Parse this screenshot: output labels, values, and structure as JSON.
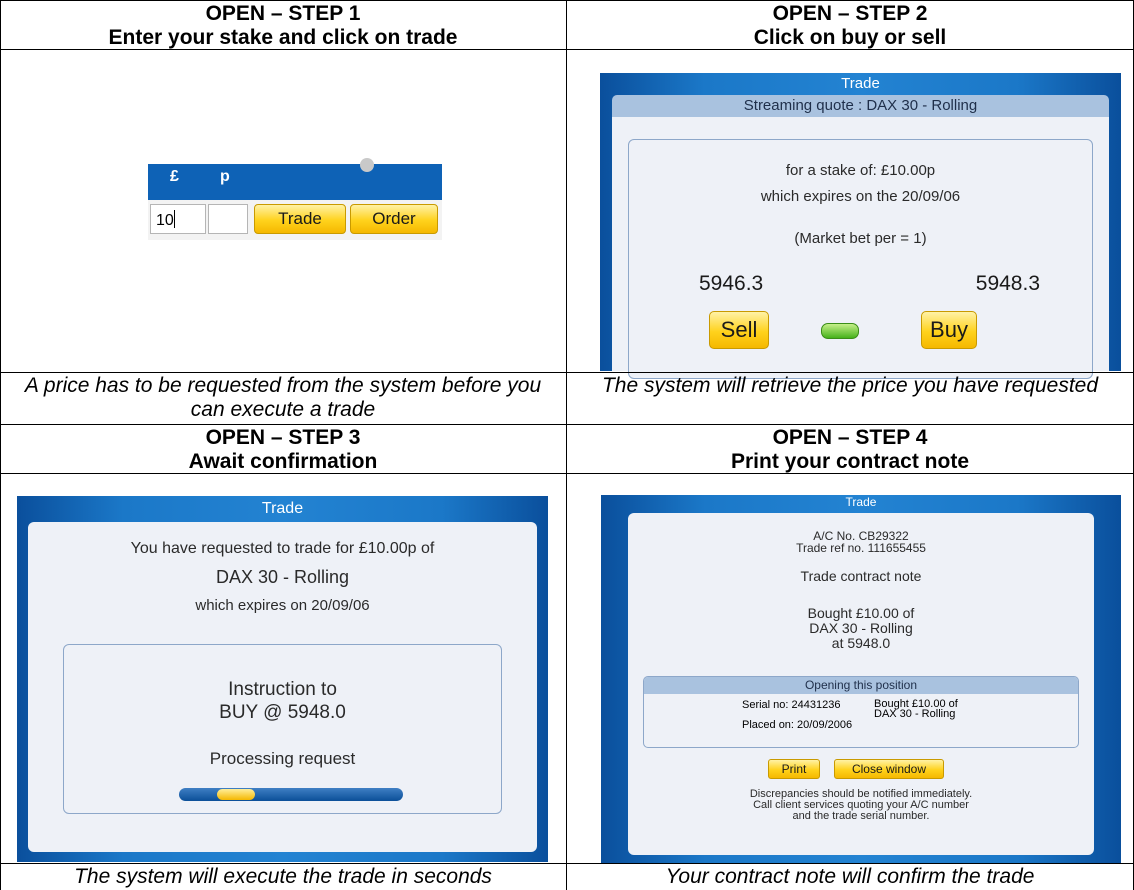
{
  "step1": {
    "heading": "OPEN – STEP 1",
    "subheading": "Enter your stake and click on trade",
    "currency_pound": "£",
    "currency_pence": "p",
    "stake_value": "10",
    "trade_button": "Trade",
    "order_button": "Order",
    "caption": "A price has to be requested from the system before you can execute a trade"
  },
  "step2": {
    "heading": "OPEN – STEP 2",
    "subheading": "Click on buy or sell",
    "dialog_title": "Trade",
    "quote_title": "Streaming quote : DAX 30 - Rolling",
    "stake_text": "for a stake of: £10.00p",
    "expiry_text": "which expires on the 20/09/06",
    "market_bet": "(Market bet per = 1)",
    "sell_price": "5946.3",
    "buy_price": "5948.3",
    "sell_button": "Sell",
    "buy_button": "Buy",
    "caption": "The system will retrieve the price you have requested"
  },
  "step3": {
    "heading": "OPEN – STEP 3",
    "subheading": "Await confirmation",
    "dialog_title": "Trade",
    "requested_text": "You have requested to trade for £10.00p of",
    "market": "DAX 30 - Rolling",
    "expiry_text": "which expires on 20/09/06",
    "instruction_line1": "Instruction to",
    "instruction_line2": "BUY @ 5948.0",
    "processing": "Processing request",
    "caption": "The system will execute the trade in seconds"
  },
  "step4": {
    "heading": "OPEN – STEP 4",
    "subheading": "Print your contract note",
    "dialog_title": "Trade",
    "ac_no": "A/C No. CB29322",
    "trade_ref": "Trade ref no. 111655455",
    "note_title": "Trade contract note",
    "bought": "Bought £10.00 of",
    "market": "DAX 30 - Rolling",
    "price": "at 5948.0",
    "position_header": "Opening this position",
    "serial": "Serial no: 24431236",
    "placed": "Placed on: 20/09/2006",
    "pos_bought": "Bought £10.00 of",
    "pos_market": "DAX 30 - Rolling",
    "print_button": "Print",
    "close_button": "Close window",
    "disclaimer1": "Discrepancies should be notified immediately.",
    "disclaimer2": "Call client services quoting your A/C number",
    "disclaimer3": "and the trade serial number.",
    "caption": "Your contract note will confirm the trade"
  }
}
